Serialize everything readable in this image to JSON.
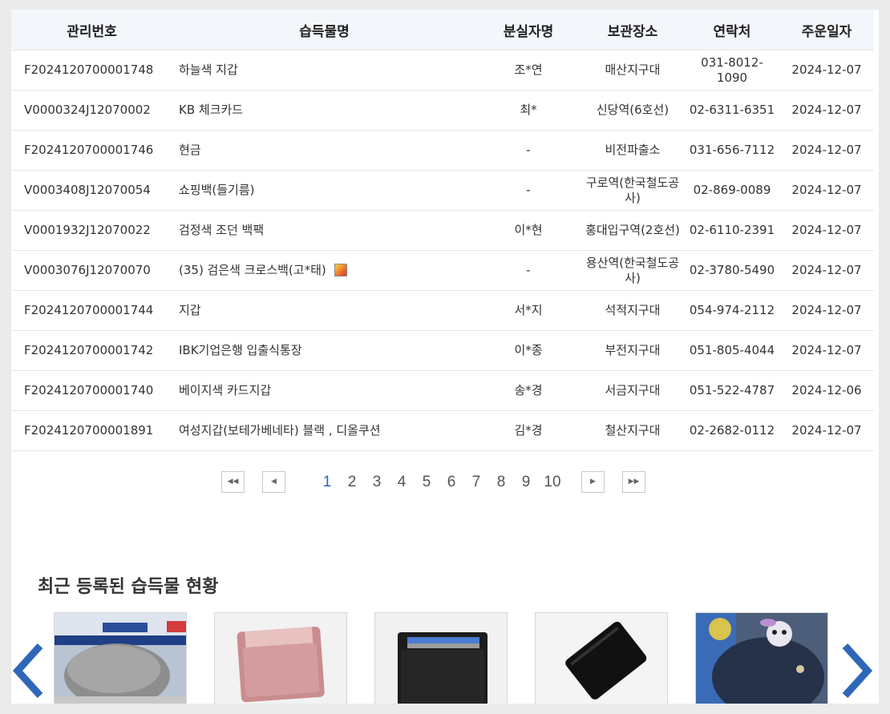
{
  "table": {
    "headers": [
      "관리번호",
      "습득물명",
      "분실자명",
      "보관장소",
      "연락처",
      "주운일자"
    ],
    "rows": [
      {
        "id": "F2024120700001748",
        "name": "하늘색 지갑",
        "owner": "조*연",
        "place": "매산지구대",
        "contact": "031-8012-1090",
        "date": "2024-12-07",
        "photo": false
      },
      {
        "id": "V0000324J12070002",
        "name": "KB 체크카드",
        "owner": "최*",
        "place": "신당역(6호선)",
        "contact": "02-6311-6351",
        "date": "2024-12-07",
        "photo": false
      },
      {
        "id": "F2024120700001746",
        "name": "현금",
        "owner": "-",
        "place": "비전파출소",
        "contact": "031-656-7112",
        "date": "2024-12-07",
        "photo": false
      },
      {
        "id": "V0003408J12070054",
        "name": "쇼핑백(들기름)",
        "owner": "-",
        "place": "구로역(한국철도공사)",
        "contact": "02-869-0089",
        "date": "2024-12-07",
        "photo": false
      },
      {
        "id": "V0001932J12070022",
        "name": "검정색 조던 백팩",
        "owner": "이*현",
        "place": "홍대입구역(2호선)",
        "contact": "02-6110-2391",
        "date": "2024-12-07",
        "photo": false
      },
      {
        "id": "V0003076J12070070",
        "name": "(35) 검은색 크로스백(고*태)",
        "owner": "-",
        "place": "용산역(한국철도공사)",
        "contact": "02-3780-5490",
        "date": "2024-12-07",
        "photo": true
      },
      {
        "id": "F2024120700001744",
        "name": "지갑",
        "owner": "서*지",
        "place": "석적지구대",
        "contact": "054-974-2112",
        "date": "2024-12-07",
        "photo": false
      },
      {
        "id": "F2024120700001742",
        "name": "IBK기업은행 입출식통장",
        "owner": "이*종",
        "place": "부전지구대",
        "contact": "051-805-4044",
        "date": "2024-12-07",
        "photo": false
      },
      {
        "id": "F2024120700001740",
        "name": "베이지색 카드지갑",
        "owner": "송*경",
        "place": "서금지구대",
        "contact": "051-522-4787",
        "date": "2024-12-06",
        "photo": false
      },
      {
        "id": "F2024120700001891",
        "name": "여성지갑(보테가베네타) 블랙 , 디올쿠션",
        "owner": "김*경",
        "place": "철산지구대",
        "contact": "02-2682-0112",
        "date": "2024-12-07",
        "photo": false
      }
    ]
  },
  "pagination": {
    "pages": [
      "1",
      "2",
      "3",
      "4",
      "5",
      "6",
      "7",
      "8",
      "9",
      "10"
    ],
    "current": "1",
    "first_icon": "double-chevron-left-icon",
    "prev_icon": "chevron-left-icon",
    "next_icon": "chevron-right-icon",
    "last_icon": "double-chevron-right-icon"
  },
  "recent": {
    "title": "최근 등록된 습득물 현황",
    "thumbnails": [
      "gray-cap-photo",
      "pink-card-wallet-photo",
      "black-card-wallet-photo",
      "black-wallet-photo",
      "backpack-with-keychain-photo"
    ]
  },
  "colors": {
    "active_page": "#2b63c1",
    "carousel_arrow": "#2f67b8",
    "header_bg": "#f3f6fa"
  }
}
